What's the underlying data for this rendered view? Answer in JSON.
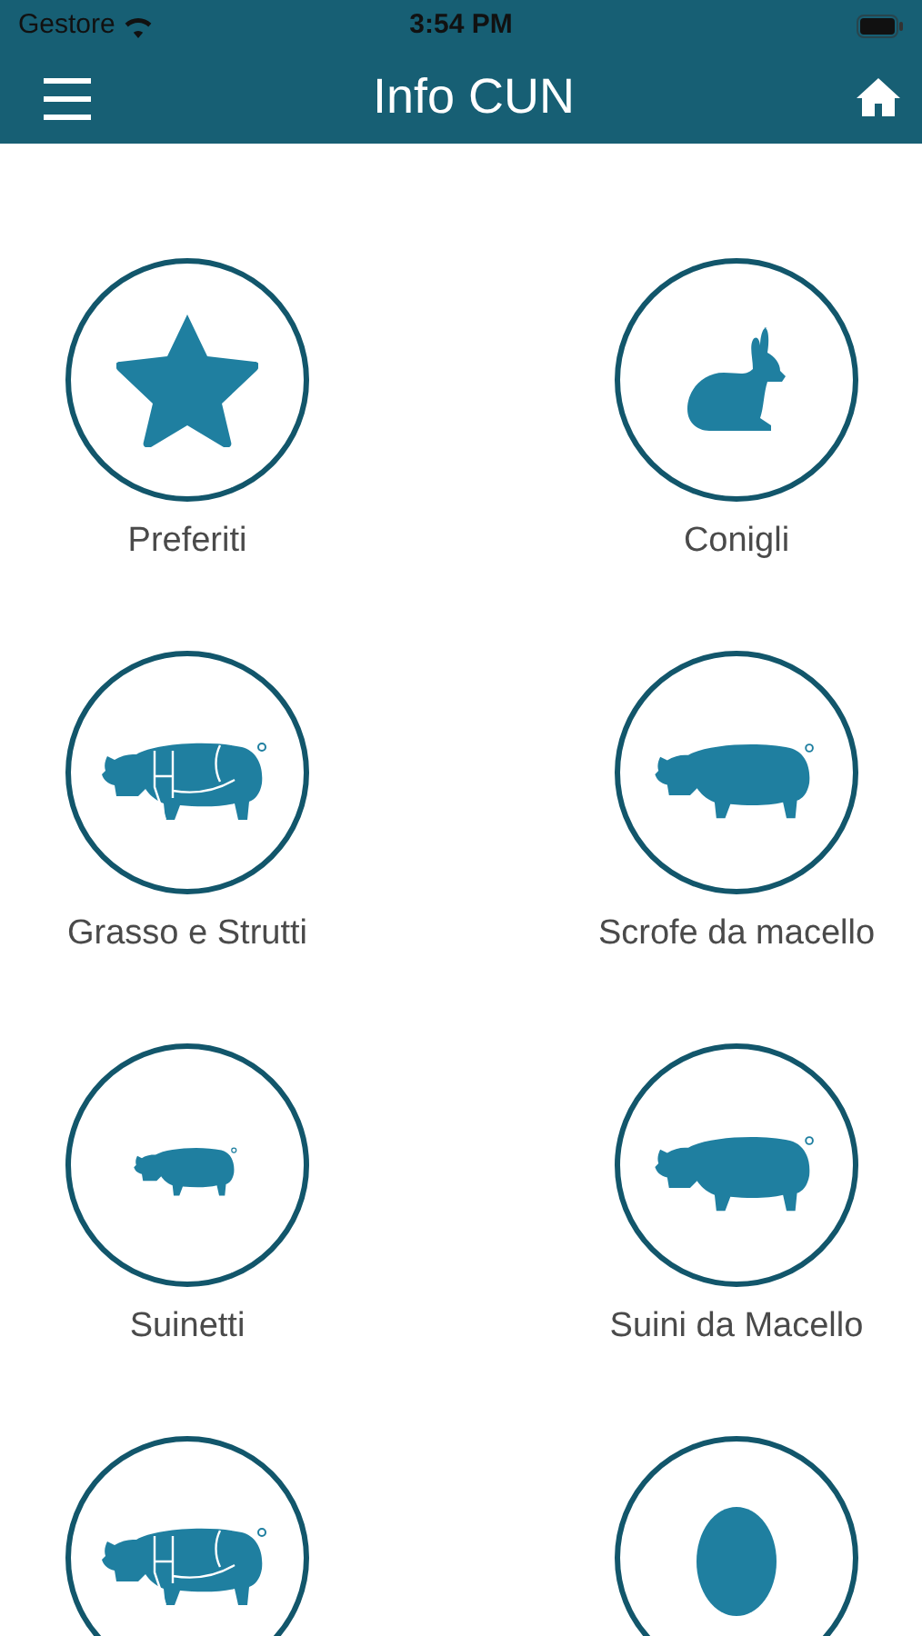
{
  "status_bar": {
    "carrier": "Gestore",
    "time": "3:54 PM"
  },
  "header": {
    "title": "Info CUN"
  },
  "tiles": [
    {
      "kind": "star",
      "label": "Preferiti"
    },
    {
      "kind": "rabbit",
      "label": "Conigli"
    },
    {
      "kind": "pig-cuts",
      "label": "Grasso e Strutti"
    },
    {
      "kind": "pig",
      "label": "Scrofe da macello"
    },
    {
      "kind": "piglet",
      "label": "Suinetti"
    },
    {
      "kind": "pig",
      "label": "Suini da Macello"
    },
    {
      "kind": "pig-cuts"
    },
    {
      "kind": "egg"
    }
  ]
}
